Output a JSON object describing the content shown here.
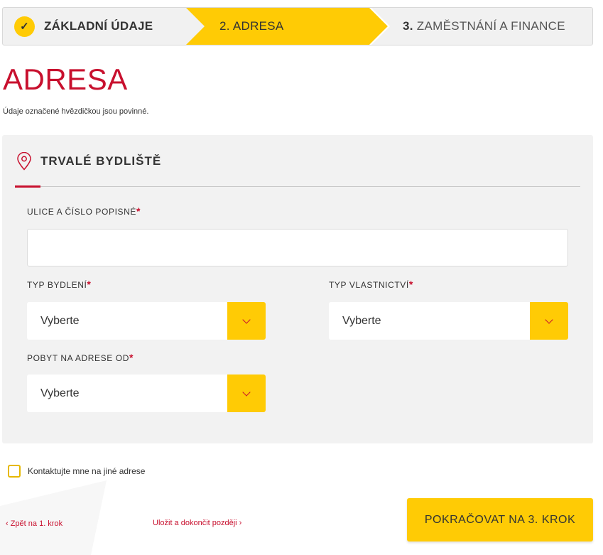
{
  "stepper": {
    "step1_label": "ZÁKLADNÍ ÚDAJE",
    "step1_check": "✓",
    "step2_label": "2. ADRESA",
    "step3_number": "3.",
    "step3_label": "ZAMĚSTNÁNÍ A FINANCE"
  },
  "page": {
    "title": "ADRESA",
    "note": "Údaje označené hvězdičkou jsou povinné."
  },
  "section": {
    "title": "TRVALÉ BYDLIŠTĚ",
    "icon": "location-pin-icon"
  },
  "form": {
    "street_label": "ULICE A ČÍSLO POPISNÉ",
    "street_value": "",
    "housing_type_label": "TYP BYDLENÍ",
    "housing_type_value": "Vyberte",
    "ownership_label": "TYP VLASTNICTVÍ",
    "ownership_value": "Vyberte",
    "stay_since_label": "POBYT NA ADRESE OD",
    "stay_since_value": "Vyberte",
    "required_mark": "*"
  },
  "contact_other": {
    "label": "Kontaktujte mne na jiné adrese",
    "checked": false
  },
  "nav": {
    "back_label": "‹ Zpět na 1. krok",
    "save_label": "Uložit a dokončit později  ›",
    "continue_label": "POKRAČOVAT NA 3. KROK"
  },
  "colors": {
    "accent_red": "#c8102e",
    "accent_yellow": "#ffcb05",
    "panel_bg": "#f2f2f2"
  }
}
